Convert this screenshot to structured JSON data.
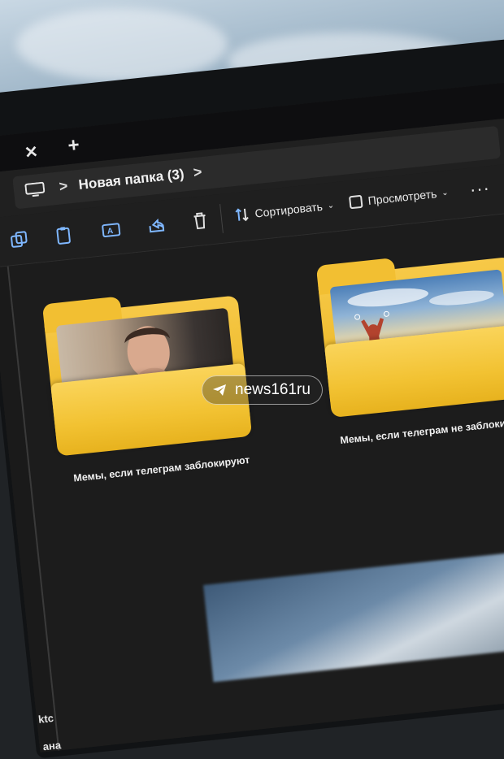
{
  "tabbar": {
    "close_glyph": "✕",
    "new_tab_glyph": "+"
  },
  "addressbar": {
    "location_icon": "monitor-icon",
    "separator": ">",
    "current_folder": "Новая папка (3)"
  },
  "toolbar": {
    "icons": [
      "copy-icon",
      "paste-icon",
      "rename-icon",
      "share-icon",
      "delete-icon"
    ],
    "sort_label": "Сортировать",
    "view_label": "Просмотреть",
    "more_label": "···"
  },
  "folders": [
    {
      "name": "Мемы, если телеграм заблокируют",
      "color": "#f2c232"
    },
    {
      "name": "Мемы, если телеграм не заблокируют",
      "color": "#f2c232"
    }
  ],
  "watermark": {
    "icon": "telegram-icon",
    "text": "news161ru"
  },
  "sidebar_fragments": [
    "ktc",
    "ана"
  ],
  "colors": {
    "folder": "#f2c232",
    "background": "#1c1c1c",
    "accent": "#4aa3ff"
  }
}
